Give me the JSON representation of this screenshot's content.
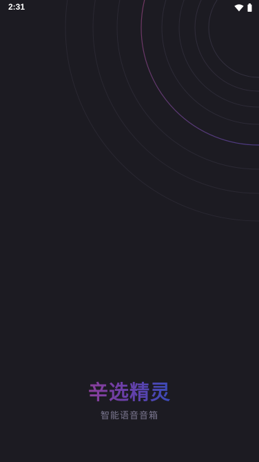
{
  "status_bar": {
    "time": "2:31",
    "icons": [
      "wifi-icon",
      "battery-icon"
    ]
  },
  "splash": {
    "title": "辛选精灵",
    "subtitle": "智能语音音箱"
  },
  "colors": {
    "background": "#1c1b22",
    "title_gradient_start": "#8b3f9a",
    "title_gradient_end": "#3a4bb8",
    "subtitle": "#7b7790"
  }
}
